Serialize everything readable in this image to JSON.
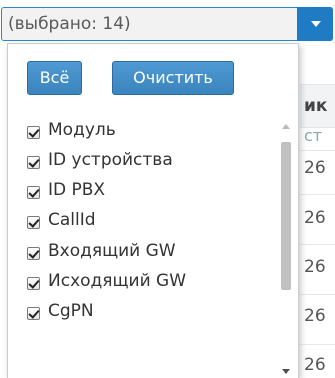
{
  "select": {
    "display_text": "(выбрано: 14)"
  },
  "dropdown": {
    "buttons": {
      "all_label": "Всё",
      "clear_label": "Очистить"
    },
    "items": [
      {
        "label": "Модуль",
        "checked": true
      },
      {
        "label": "ID устройства",
        "checked": true
      },
      {
        "label": "ID PBX",
        "checked": true
      },
      {
        "label": "CallId",
        "checked": true
      },
      {
        "label": "Входящий GW",
        "checked": true
      },
      {
        "label": "Исходящий GW",
        "checked": true
      },
      {
        "label": "CgPN",
        "checked": true
      }
    ]
  },
  "background": {
    "header_fragment": "ик",
    "subheader_fragment": "ст",
    "row_fragments": [
      "26",
      "26",
      "26",
      "26",
      "26"
    ]
  },
  "colors": {
    "accent": "#1f7bc4",
    "button": "#3b84be"
  }
}
